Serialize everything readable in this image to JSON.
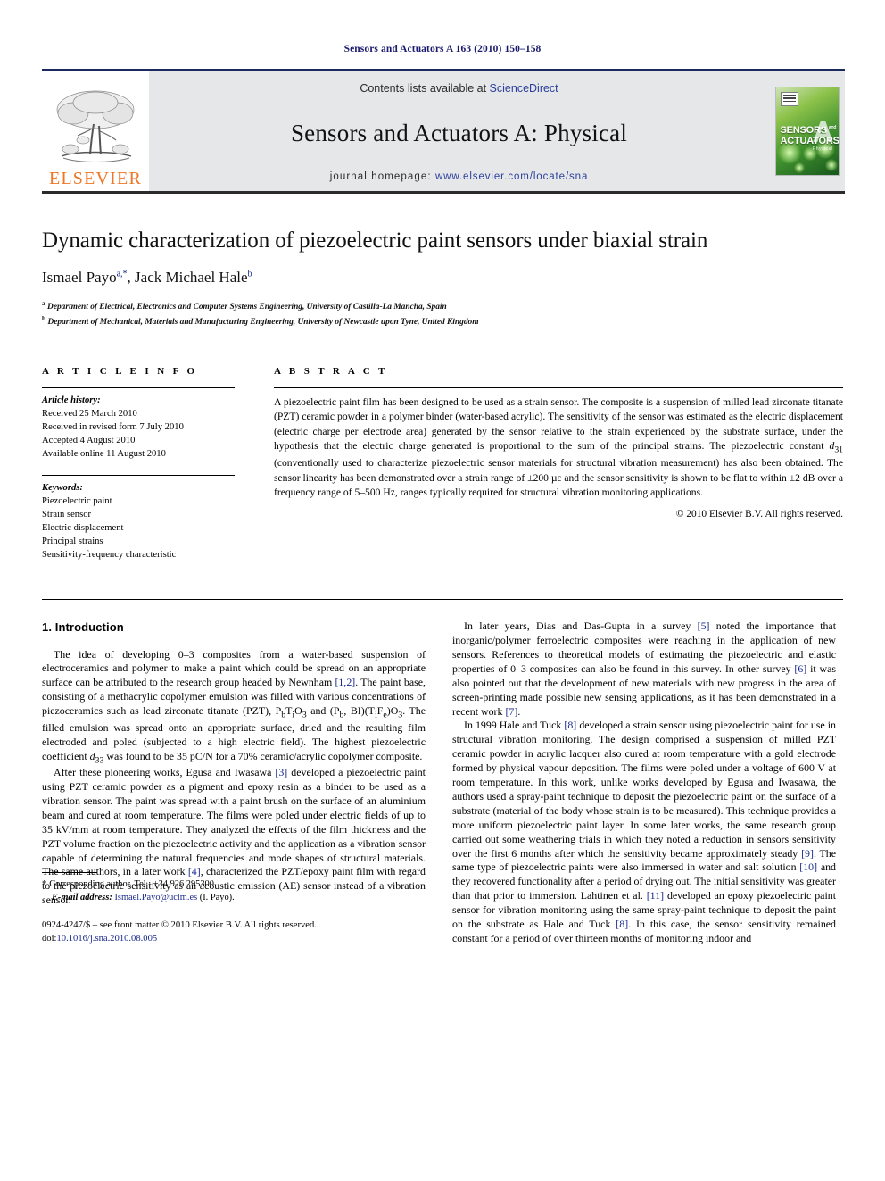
{
  "running_head": "Sensors and Actuators A 163 (2010) 150–158",
  "masthead": {
    "publisher_name": "ELSEVIER",
    "contents_prefix": "Contents lists available at ",
    "contents_link": "ScienceDirect",
    "journal_name": "Sensors and Actuators A: Physical",
    "homepage_label": "journal homepage:",
    "homepage_url": "www.elsevier.com/locate/sna",
    "cover": {
      "line1": "SENSORS",
      "and": "and",
      "line2": "ACTUATORS",
      "letter": "A",
      "subtitle": "Physical"
    }
  },
  "article": {
    "title": "Dynamic characterization of piezoelectric paint sensors under biaxial strain",
    "authors_html": "Ismael Payo<sup>a,*</sup>, Jack Michael Hale<sup>b</sup>",
    "affiliation_a_marker": "a",
    "affiliation_a": "Department of Electrical, Electronics and Computer Systems Engineering, University of Castilla-La Mancha, Spain",
    "affiliation_b_marker": "b",
    "affiliation_b": "Department of Mechanical, Materials and Manufacturing Engineering, University of Newcastle upon Tyne, United Kingdom"
  },
  "info": {
    "heading": "A R T I C L E  I N F O",
    "history_label": "Article history:",
    "history": [
      "Received 25 March 2010",
      "Received in revised form 7 July 2010",
      "Accepted 4 August 2010",
      "Available online 11 August 2010"
    ],
    "keywords_label": "Keywords:",
    "keywords": [
      "Piezoelectric paint",
      "Strain sensor",
      "Electric displacement",
      "Principal strains",
      "Sensitivity-frequency characteristic"
    ]
  },
  "abstract": {
    "heading": "A B S T R A C T",
    "text": "A piezoelectric paint film has been designed to be used as a strain sensor. The composite is a suspension of milled lead zirconate titanate (PZT) ceramic powder in a polymer binder (water-based acrylic). The sensitivity of the sensor was estimated as the electric displacement (electric charge per electrode area) generated by the sensor relative to the strain experienced by the substrate surface, under the hypothesis that the electric charge generated is proportional to the sum of the principal strains. The piezoelectric constant d31 (conventionally used to characterize piezoelectric sensor materials for structural vibration measurement) has also been obtained. The sensor linearity has been demonstrated over a strain range of ±200 µε and the sensor sensitivity is shown to be flat to within ±2 dB over a frequency range of 5–500 Hz, ranges typically required for structural vibration monitoring applications.",
    "copyright": "© 2010 Elsevier B.V. All rights reserved."
  },
  "body": {
    "section_number_title": "1. Introduction",
    "left_paragraphs": [
      "The idea of developing 0–3 composites from a water-based suspension of electroceramics and polymer to make a paint which could be spread on an appropriate surface can be attributed to the research group headed by Newnham [1,2]. The paint base, consisting of a methacrylic copolymer emulsion was filled with various concentrations of piezoceramics such as lead zirconate titanate (PZT), PbTiO3 and (Pb, BI)(TiFe)O3. The filled emulsion was spread onto an appropriate surface, dried and the resulting film electroded and poled (subjected to a high electric field). The highest piezoelectric coefficient d33 was found to be 35 pC/N for a 70% ceramic/acrylic copolymer composite.",
      "After these pioneering works, Egusa and Iwasawa [3] developed a piezoelectric paint using PZT ceramic powder as a pigment and epoxy resin as a binder to be used as a vibration sensor. The paint was spread with a paint brush on the surface of an aluminium beam and cured at room temperature. The films were poled under electric fields of up to 35 kV/mm at room temperature. They analyzed the effects of the film thickness and the PZT volume fraction on the piezoelectric activity and the application as a vibration sensor capable of determining the natural frequencies and mode shapes of structural materials. The same authors, in a later work [4], characterized the PZT/epoxy paint film with regard to the piezoelectric sensitivity as an acoustic emission (AE) sensor instead of a vibration sensor."
    ],
    "right_paragraphs": [
      "In later years, Dias and Das-Gupta in a survey [5] noted the importance that inorganic/polymer ferroelectric composites were reaching in the application of new sensors. References to theoretical models of estimating the piezoelectric and elastic properties of 0–3 composites can also be found in this survey. In other survey [6] it was also pointed out that the development of new materials with new progress in the area of screen-printing made possible new sensing applications, as it has been demonstrated in a recent work [7].",
      "In 1999 Hale and Tuck [8] developed a strain sensor using piezoelectric paint for use in structural vibration monitoring. The design comprised a suspension of milled PZT ceramic powder in acrylic lacquer also cured at room temperature with a gold electrode formed by physical vapour deposition. The films were poled under a voltage of 600 V at room temperature. In this work, unlike works developed by Egusa and Iwasawa, the authors used a spray-paint technique to deposit the piezoelectric paint on the surface of a substrate (material of the body whose strain is to be measured). This technique provides a more uniform piezoelectric paint layer. In some later works, the same research group carried out some weathering trials in which they noted a reduction in sensors sensitivity over the first 6 months after which the sensitivity became approximately steady [9]. The same type of piezoelectric paints were also immersed in water and salt solution [10] and they recovered functionality after a period of drying out. The initial sensitivity was greater than that prior to immersion. Lahtinen et al. [11] developed an epoxy piezoelectric paint sensor for vibration monitoring using the same spray-paint technique to deposit the paint on the substrate as Hale and Tuck [8]. In this case, the sensor sensitivity remained constant for a period of over thirteen months of monitoring indoor and"
    ]
  },
  "footer": {
    "corresponding_star": "*",
    "corresponding_text": "Corresponding author. Tel.: +34 926 295300.",
    "email_label": "E-mail address:",
    "email": "Ismael.Payo@uclm.es",
    "email_owner": "(I. Payo).",
    "issn_line": "0924-4247/$ – see front matter © 2010 Elsevier B.V. All rights reserved.",
    "doi_label": "doi:",
    "doi": "10.1016/j.sna.2010.08.005"
  },
  "colors": {
    "link_blue": "#1a2a8e",
    "elsevier_orange": "#ee7624",
    "masthead_gray": "#e6e7e8"
  }
}
